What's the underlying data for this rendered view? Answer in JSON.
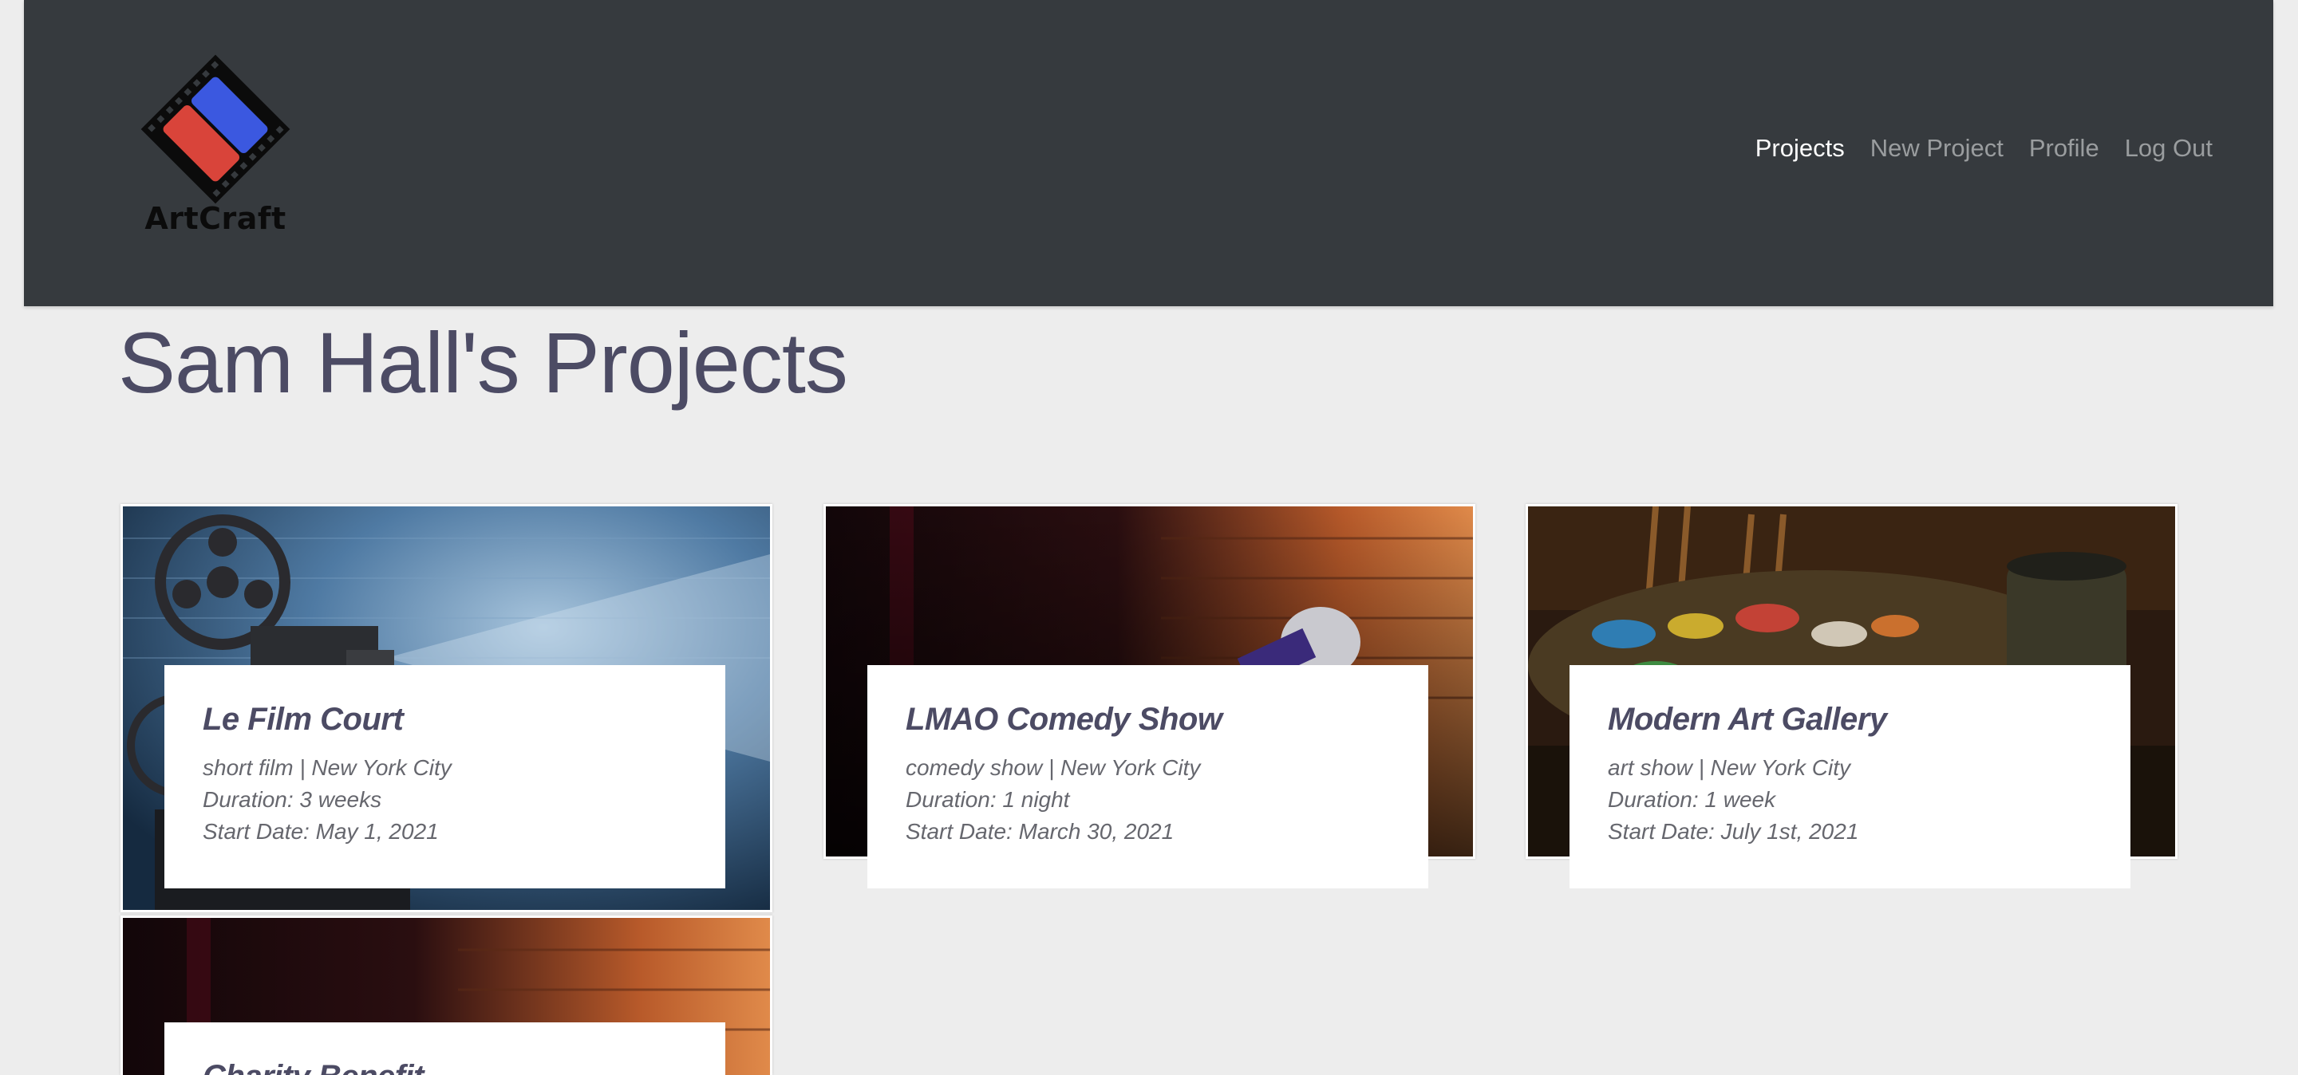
{
  "brand": {
    "name": "ArtCraft",
    "colors": {
      "red": "#d9443a",
      "blue": "#3b58e0",
      "navbar": "#363a3e"
    }
  },
  "nav": {
    "links": [
      {
        "label": "Projects",
        "active": true
      },
      {
        "label": "New Project",
        "active": false
      },
      {
        "label": "Profile",
        "active": false
      },
      {
        "label": "Log Out",
        "active": false
      }
    ]
  },
  "page": {
    "title": "Sam Hall's Projects"
  },
  "projects": [
    {
      "title": "Le Film Court",
      "meta": "short film | New York City",
      "duration": "Duration: 3 weeks",
      "start": "Start Date: May 1, 2021",
      "image": "film-projector-image"
    },
    {
      "title": "LMAO Comedy Show",
      "meta": "comedy show | New York City",
      "duration": "Duration: 1 night",
      "start": "Start Date: March 30, 2021",
      "image": "microphone-brick-wall-image"
    },
    {
      "title": "Modern Art Gallery",
      "meta": "art show | New York City",
      "duration": "Duration: 1 week",
      "start": "Start Date: July 1st, 2021",
      "image": "paint-palette-image"
    },
    {
      "title": "Charity Benefit",
      "image": "microphone-brick-wall-image"
    }
  ]
}
